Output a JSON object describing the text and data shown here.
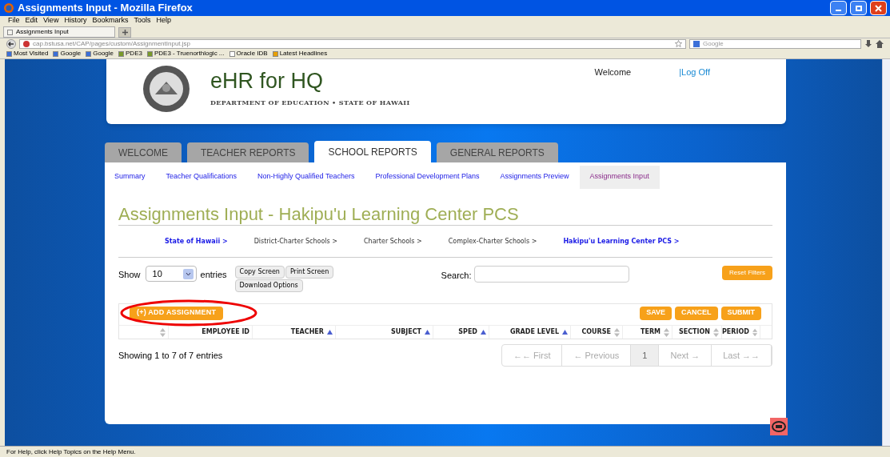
{
  "window": {
    "title": "Assignments Input - Mozilla Firefox"
  },
  "menu": [
    "File",
    "Edit",
    "View",
    "History",
    "Bookmarks",
    "Tools",
    "Help"
  ],
  "browser_tabs": [
    {
      "label": "Assignments Input",
      "selected": true
    }
  ],
  "address": "cap.bstusa.net/CAP/pages/custom/AssignmentInput.jsp",
  "search_engine": {
    "placeholder": "Google"
  },
  "bookmarks": [
    "Most Visited",
    "Google",
    "Google",
    "PDE3",
    "PDE3 - Truenorthlogic ...",
    "Oracle IDB",
    "Latest Headlines"
  ],
  "header": {
    "app_title": "eHR for HQ",
    "subtitle": "DEPARTMENT OF EDUCATION • STATE OF HAWAII",
    "welcome": "Welcome",
    "logoff": "|Log Off"
  },
  "main_tabs": [
    {
      "label": "WELCOME",
      "selected": false
    },
    {
      "label": "TEACHER REPORTS",
      "selected": false
    },
    {
      "label": "SCHOOL REPORTS",
      "selected": true
    },
    {
      "label": "GENERAL REPORTS",
      "selected": false
    }
  ],
  "sub_nav": [
    {
      "label": "Summary",
      "selected": false
    },
    {
      "label": "Teacher Qualifications",
      "selected": false
    },
    {
      "label": "Non-Highly Qualified Teachers",
      "selected": false
    },
    {
      "label": "Professional Development Plans",
      "selected": false
    },
    {
      "label": "Assignments Preview",
      "selected": false
    },
    {
      "label": "Assignments Input",
      "selected": true
    }
  ],
  "page_title": "Assignments Input - Hakipu'u Learning Center PCS",
  "breadcrumb": [
    {
      "label": "State of Hawaii >",
      "bold": true
    },
    {
      "label": "District-Charter Schools >",
      "bold": false
    },
    {
      "label": "Charter Schools >",
      "bold": false
    },
    {
      "label": "Complex-Charter Schools >",
      "bold": false
    },
    {
      "label": "Hakipu'u Learning Center PCS >",
      "bold": true
    }
  ],
  "show": {
    "label": "Show",
    "value": "10",
    "suffix": "entries"
  },
  "tools": [
    "Copy Screen",
    "Print Screen",
    "Download Options"
  ],
  "search": {
    "label": "Search:"
  },
  "reset_button": "Reset Filters",
  "add_button": "(+) ADD ASSIGNMENT",
  "actions": [
    "SAVE",
    "CANCEL",
    "SUBMIT"
  ],
  "columns": [
    {
      "sorted": false
    },
    {
      "label": "EMPLOYEE ID"
    },
    {
      "label": "TEACHER",
      "sorted": true
    },
    {
      "label": "SUBJECT",
      "sorted": true
    },
    {
      "label": "SPED",
      "sorted": true
    },
    {
      "label": "GRADE LEVEL",
      "sorted": true
    },
    {
      "label": "COURSE",
      "sorted": false
    },
    {
      "label": "TERM",
      "sorted": false
    },
    {
      "label": "SECTION",
      "sorted": false
    },
    {
      "label": "PERIOD",
      "sorted": false
    }
  ],
  "info": "Showing 1 to 7 of 7 entries",
  "pager": [
    {
      "label": "←← First",
      "disabled": true,
      "selected": false
    },
    {
      "label": "← Previous",
      "disabled": true,
      "selected": false
    },
    {
      "label": "1",
      "disabled": false,
      "selected": true
    },
    {
      "label": "Next →",
      "disabled": true,
      "selected": false
    },
    {
      "label": "Last →→",
      "disabled": true,
      "selected": false
    }
  ],
  "status_bar": "For Help, click Help Topics on the Help Menu."
}
